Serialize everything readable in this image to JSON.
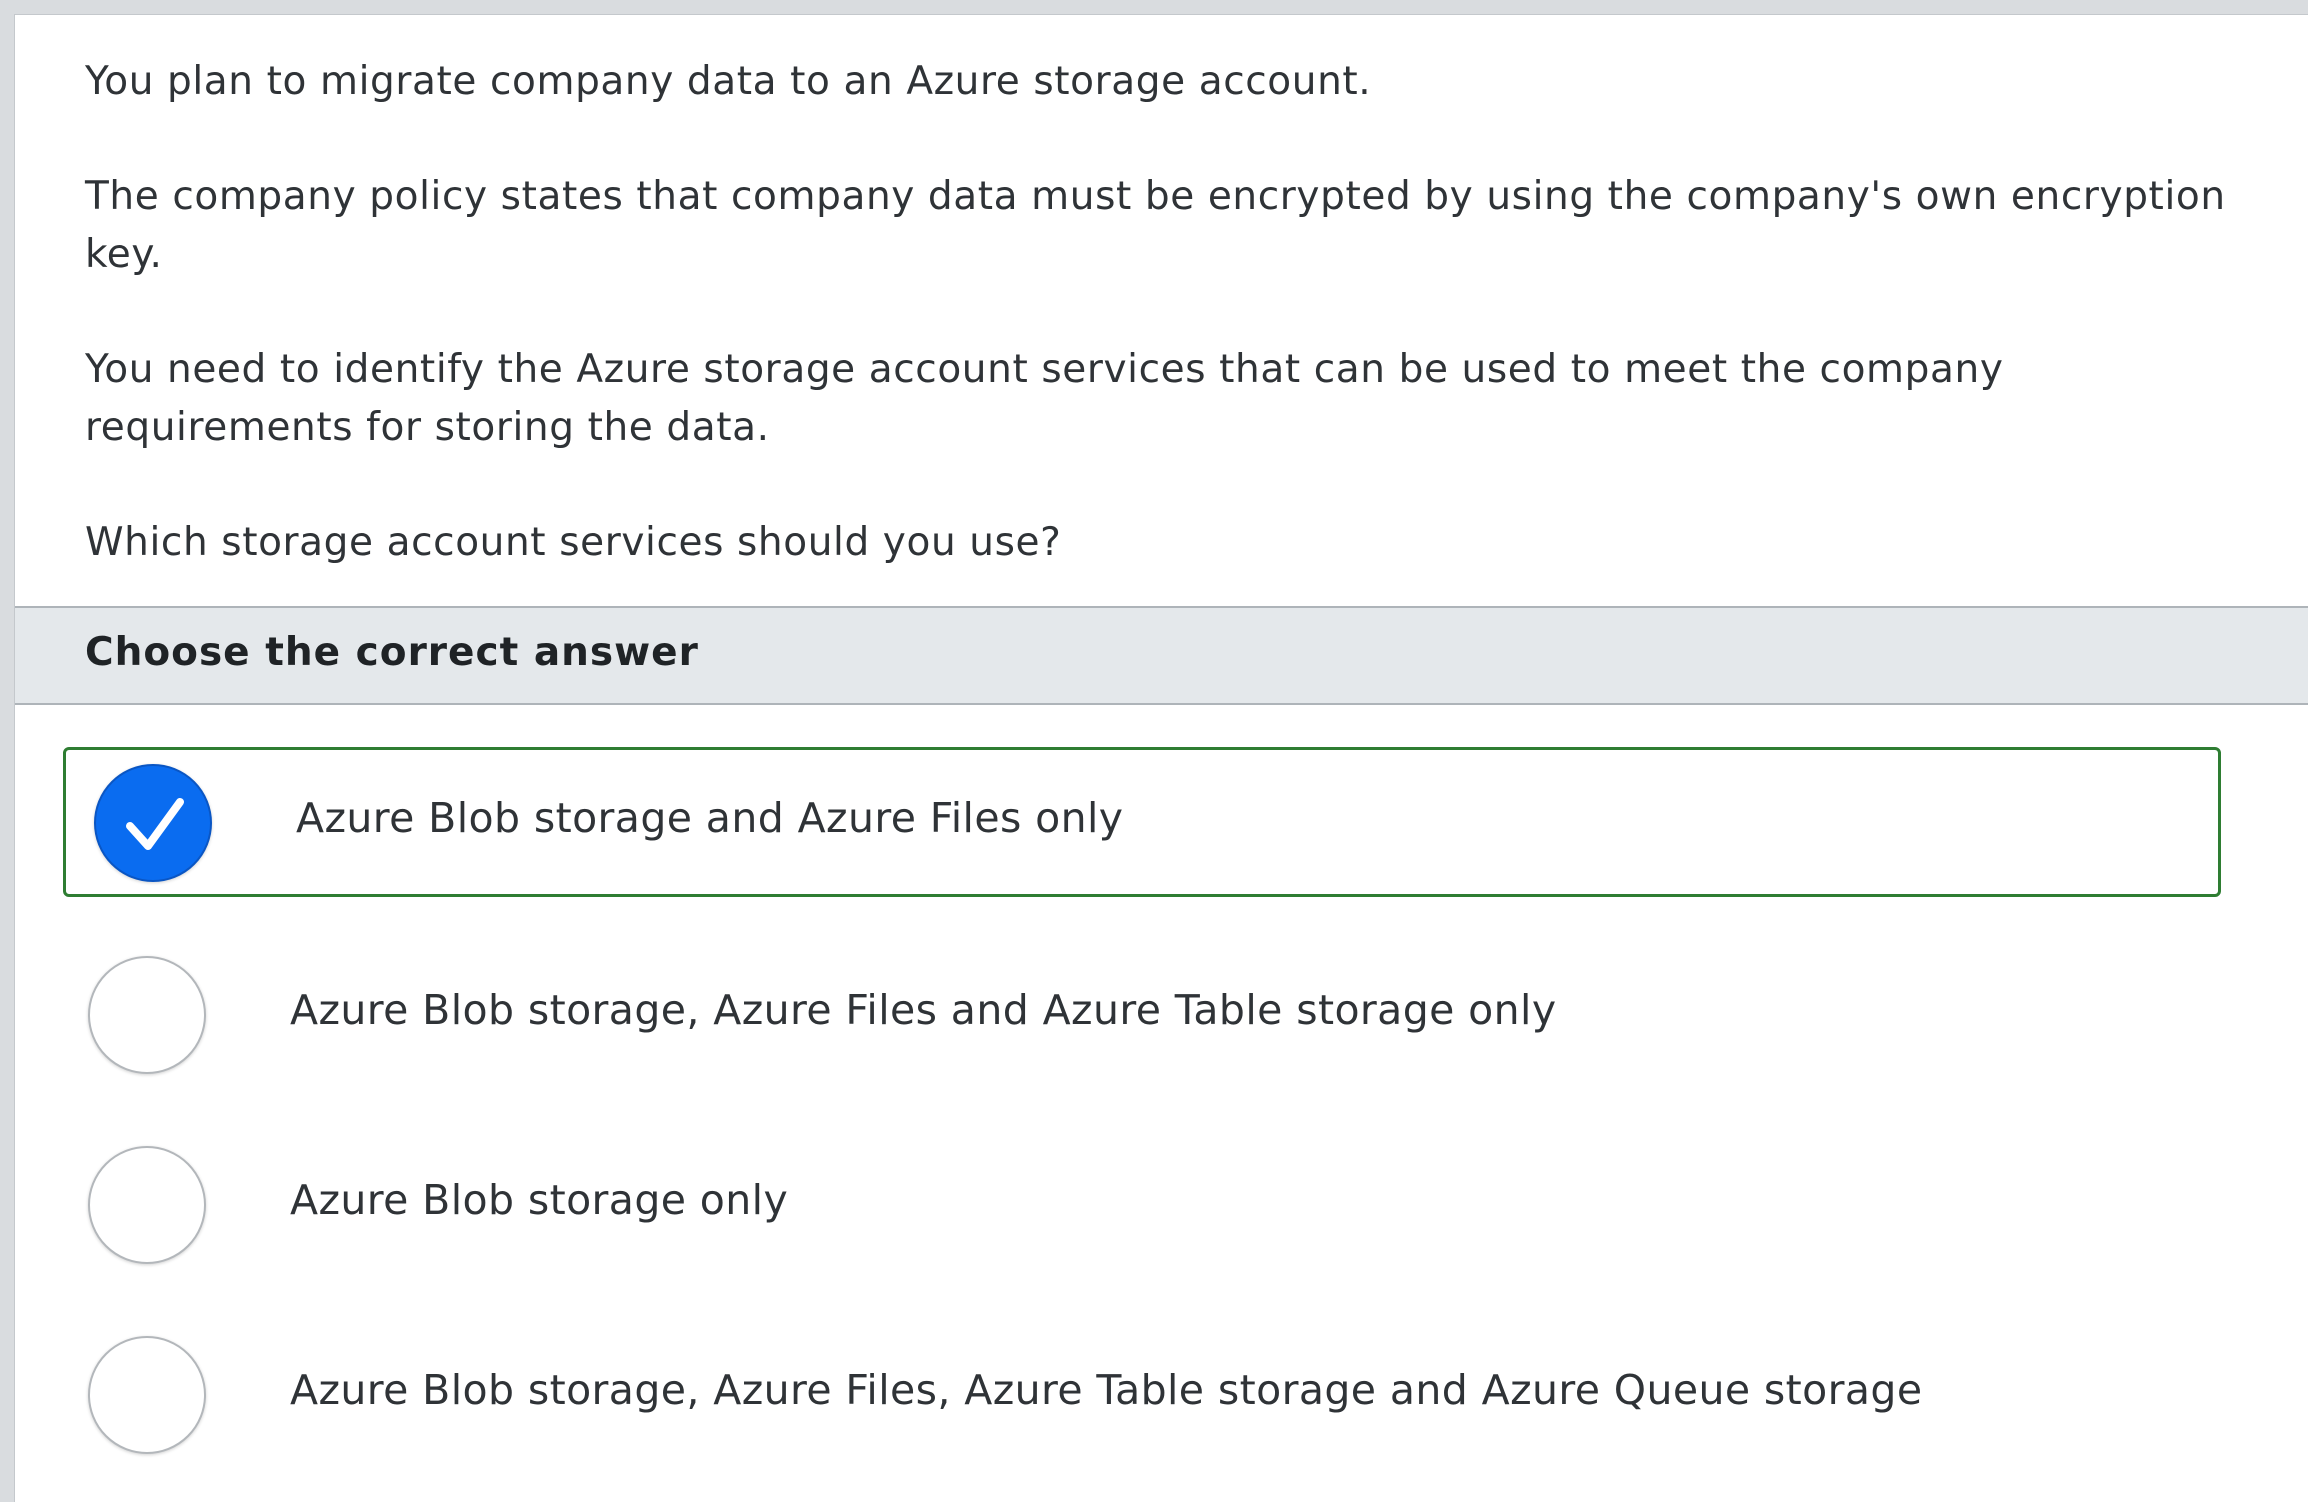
{
  "question": {
    "paragraphs": [
      "You plan to migrate company data to an Azure storage account.",
      "The company policy states that company data must be encrypted by using the company's own encryption key.",
      "You need to identify the Azure storage account services that can be used to meet the company requirements for storing the data.",
      "Which storage account services should you use?"
    ]
  },
  "answer_header": "Choose the correct answer",
  "options": [
    {
      "label": "Azure Blob storage and Azure Files only",
      "selected": true
    },
    {
      "label": "Azure Blob storage, Azure Files and Azure Table storage only",
      "selected": false
    },
    {
      "label": "Azure Blob storage only",
      "selected": false
    },
    {
      "label": "Azure Blob storage, Azure Files, Azure Table storage and Azure Queue storage",
      "selected": false
    }
  ],
  "colors": {
    "selected_border": "#2e7d32",
    "check_fill": "#0a6cf0",
    "header_bg": "#e4e8eb",
    "text": "#2f3337"
  },
  "icons": {
    "checked": "checkmark-icon"
  }
}
